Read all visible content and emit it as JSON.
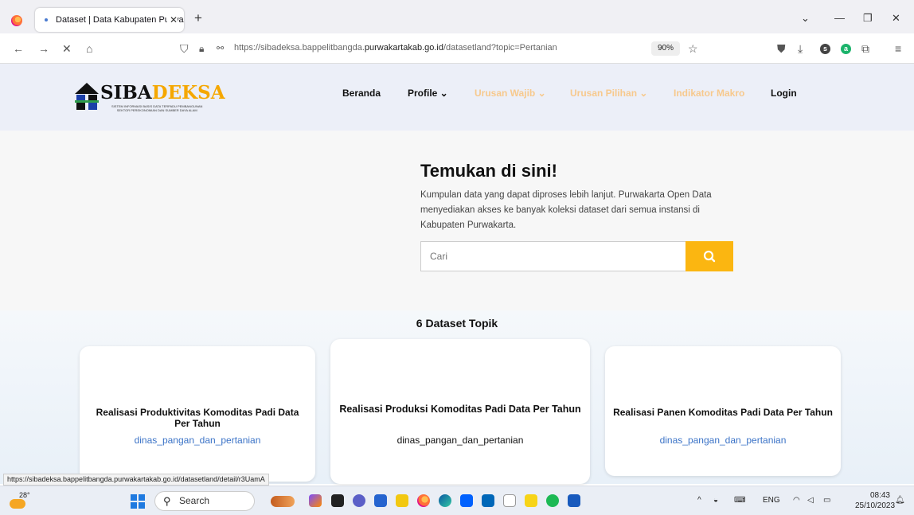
{
  "browser": {
    "tab_title": "Dataset | Data Kabupaten Purwakarta",
    "tab_close": "✕",
    "new_tab": "+",
    "url_prefix": "https://sibadeksa.bappelitbangda.",
    "url_domain": "purwakartakab.go.id",
    "url_path": "/datasetland?topic=Pertanian",
    "zoom": "90%"
  },
  "site": {
    "logo_title_a": "SIBA",
    "logo_title_b": "DEKSA",
    "logo_sub_line1": "SISTEM INFORMASI BASIS DATA TERPADU PEMBANGUNAN",
    "logo_sub_line2": "SEKTOR PEREKONOMIAN DAN SUMBER DAYA ALAM",
    "nav": {
      "beranda": "Beranda",
      "profile": "Profile ⌄",
      "urusan_wajib": "Urusan Wajib ⌄",
      "urusan_pilihan": "Urusan Pilihan ⌄",
      "indikator_makro": "Indikator Makro",
      "login": "Login"
    }
  },
  "hero": {
    "title": "Temukan di sini!",
    "description": "Kumpulan data yang dapat diproses lebih lanjut. Purwakarta Open Data menyediakan akses ke banyak koleksi dataset dari semua instansi di Kabupaten Purwakarta.",
    "search_placeholder": "Cari"
  },
  "datasets": {
    "heading": "6 Dataset Topik",
    "cards": [
      {
        "title": "Realisasi Produktivitas Komoditas Padi Data Per Tahun",
        "org": "dinas_pangan_dan_pertanian"
      },
      {
        "title": "Realisasi Produksi Komoditas Padi Data Per Tahun",
        "org": "dinas_pangan_dan_pertanian"
      },
      {
        "title": "Realisasi Panen Komoditas Padi Data Per Tahun",
        "org": "dinas_pangan_dan_pertanian"
      }
    ]
  },
  "status_url": "https://sibadeksa.bappelitbangda.purwakartakab.go.id/datasetland/detail/r3UamA",
  "taskbar": {
    "weather": "28°",
    "search": "Search",
    "lang": "ENG",
    "time": "08:43",
    "date": "25/10/2023"
  },
  "colors": {
    "accent": "#fbb611",
    "link_blue": "#3b73c7",
    "menu_disabled": "#f7c98d",
    "header_bg": "#eceff8"
  }
}
